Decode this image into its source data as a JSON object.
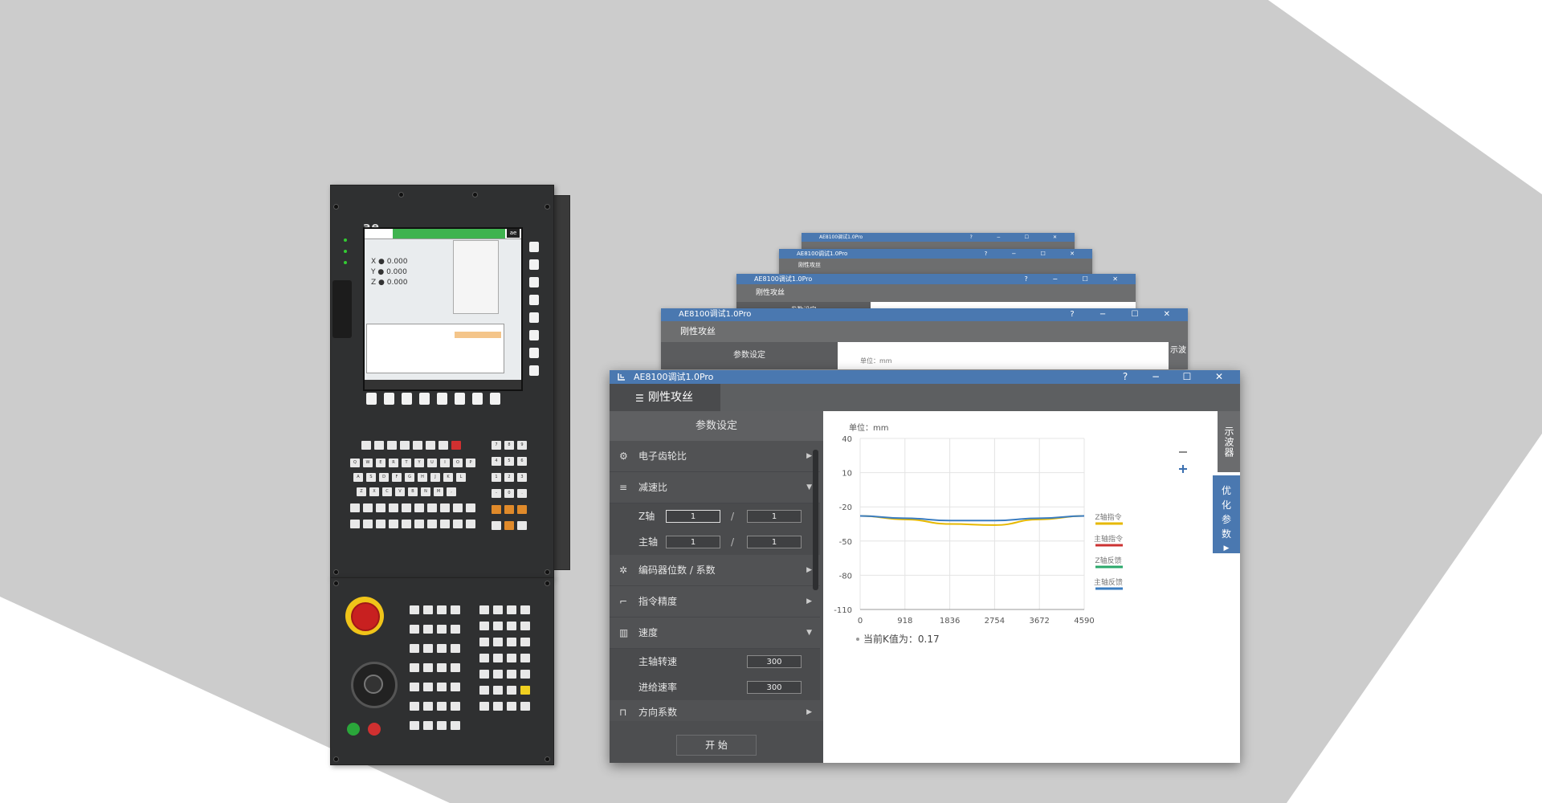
{
  "colors": {
    "background": "#cccccc",
    "accent_blue": "#4a78b0",
    "sidebar_bg": "#515254",
    "titlebar": "#4a78b0"
  },
  "window": {
    "title": "AE8100调试1.0Pro",
    "controls": {
      "help": "?",
      "minimize": "−",
      "maximize": "☐",
      "close": "✕"
    }
  },
  "ghost_windows": {
    "title": "AE8100调试1.0Pro",
    "tab": "刚性攻丝",
    "section": "参数设定",
    "unit": "单位：mm",
    "side": "示波"
  },
  "tab": {
    "label": "刚性攻丝",
    "icon": "tap-icon"
  },
  "sidebar": {
    "header": "参数设定",
    "items": [
      {
        "label": "电子齿轮比",
        "icon": "gear-icon",
        "arrow": "▶"
      },
      {
        "label": "减速比",
        "icon": "ratio-icon",
        "arrow": "▼"
      },
      {
        "label": "编码器位数 / 系数",
        "icon": "encoder-icon",
        "arrow": "▶"
      },
      {
        "label": "指令精度",
        "icon": "precision-icon",
        "arrow": "▶"
      },
      {
        "label": "速度",
        "icon": "speed-icon",
        "arrow": "▼"
      },
      {
        "label": "方向系数",
        "icon": "direction-icon",
        "arrow": "▶"
      }
    ],
    "ratio": {
      "z_label": "Z轴",
      "z_num": "1",
      "z_den": "1",
      "spindle_label": "主轴",
      "spindle_num": "1",
      "spindle_den": "1",
      "slash": "/"
    },
    "speed": {
      "spindle_label": "主轴转速",
      "spindle_value": "300",
      "feed_label": "进给速率",
      "feed_value": "300"
    },
    "start_button": "开 始"
  },
  "right_tabs": {
    "oscilloscope": "示波器",
    "optimize": "优化参数"
  },
  "zoom": {
    "minus": "−",
    "plus": "+"
  },
  "chart_data": {
    "type": "line",
    "unit_label": "单位：mm",
    "x_ticks": [
      0,
      918,
      1836,
      2754,
      3672,
      4590
    ],
    "y_ticks": [
      40,
      10,
      -20,
      -50,
      -80,
      -110
    ],
    "xlim": [
      0,
      4590
    ],
    "ylim": [
      -110,
      40
    ],
    "grid": true,
    "legend_position": "right",
    "series": [
      {
        "name": "Z轴指令",
        "color": "#e6b800",
        "x": [
          0,
          918,
          1836,
          2754,
          3672,
          4590
        ],
        "y": [
          -28,
          -31,
          -35,
          -36,
          -31,
          -28
        ]
      },
      {
        "name": "主轴指令",
        "color": "#cc3333",
        "x": [],
        "y": []
      },
      {
        "name": "Z轴反馈",
        "color": "#2aa86a",
        "x": [],
        "y": []
      },
      {
        "name": "主轴反馈",
        "color": "#3a7cc0",
        "x": [
          0,
          918,
          1836,
          2754,
          3672,
          4590
        ],
        "y": [
          -28,
          -30,
          -32,
          -32,
          -30,
          -28
        ]
      }
    ],
    "annotation": "当前K值为：0.17"
  }
}
